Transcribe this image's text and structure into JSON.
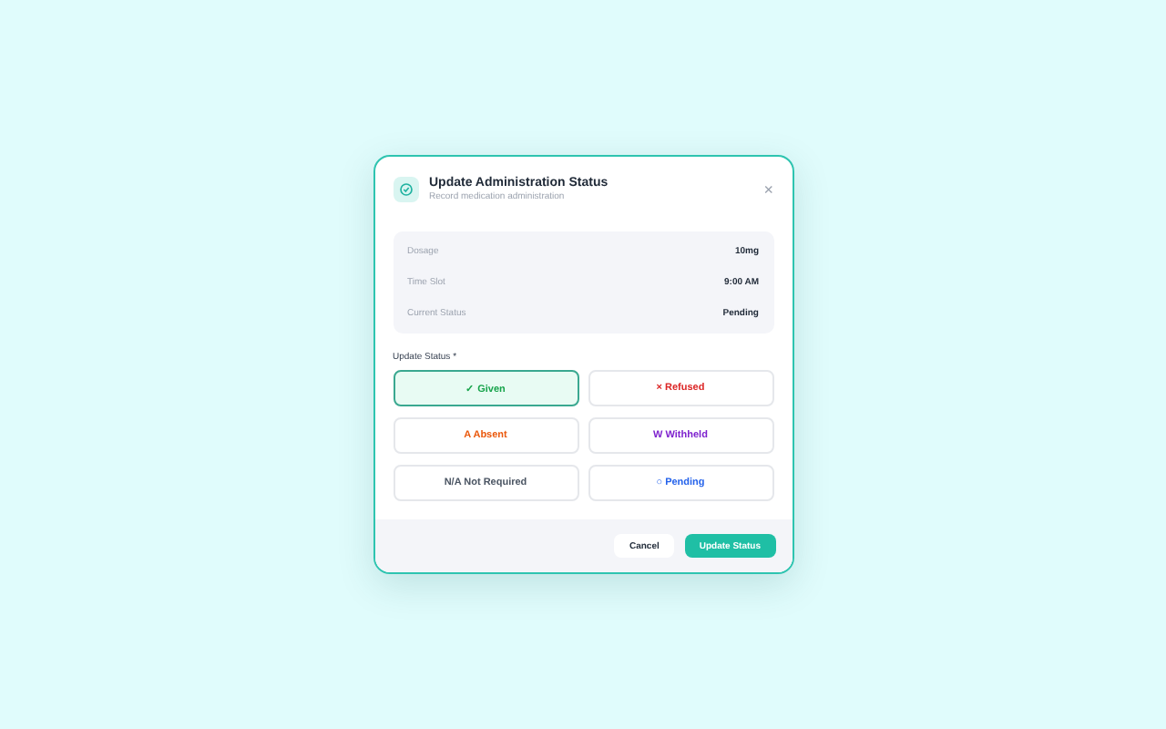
{
  "dialog": {
    "title": "Update Administration Status",
    "subtitle": "Record medication administration",
    "close": "×"
  },
  "details": [
    {
      "label": "Dosage",
      "value": "10mg"
    },
    {
      "label": "Time Slot",
      "value": "9:00 AM"
    },
    {
      "label": "Current Status",
      "value": "Pending"
    }
  ],
  "status_label": "Update Status",
  "required_mark": "*",
  "options": [
    {
      "label": "✓ Given",
      "color": "#16a34a",
      "selected": true
    },
    {
      "label": "× Refused",
      "color": "#dc2626",
      "selected": false
    },
    {
      "label": "A Absent",
      "color": "#ea580c",
      "selected": false
    },
    {
      "label": "W Withheld",
      "color": "#7e22ce",
      "selected": false
    },
    {
      "label": "N/A Not Required",
      "color": "#4b5563",
      "selected": false
    },
    {
      "label": "○ Pending",
      "color": "#2563eb",
      "selected": false
    }
  ],
  "buttons": {
    "cancel": "Cancel",
    "submit": "Update Status"
  }
}
